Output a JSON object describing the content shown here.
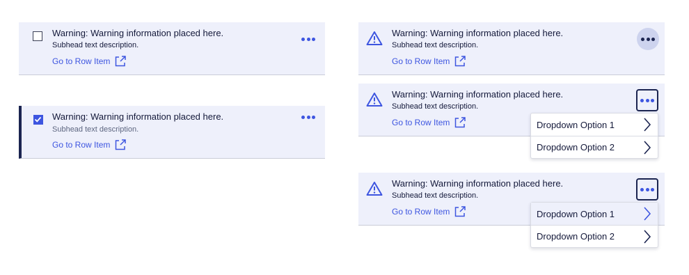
{
  "row": {
    "title": "Warning: Warning information placed here.",
    "subhead": "Subhead text description.",
    "link": "Go to Row Item"
  },
  "dropdown": {
    "option1": "Dropdown Option 1",
    "option2": "Dropdown Option 2"
  },
  "icons": {
    "checkbox": "checkbox-icon",
    "warning": "warning-triangle-icon",
    "external_link": "external-link-icon",
    "more": "more-horizontal-icon",
    "chevron": "chevron-right-icon"
  },
  "colors": {
    "row_bg": "#eef0fb",
    "accent": "#3d55e0",
    "navy": "#1b2450",
    "text": "#14193a",
    "muted": "#5d6680"
  }
}
